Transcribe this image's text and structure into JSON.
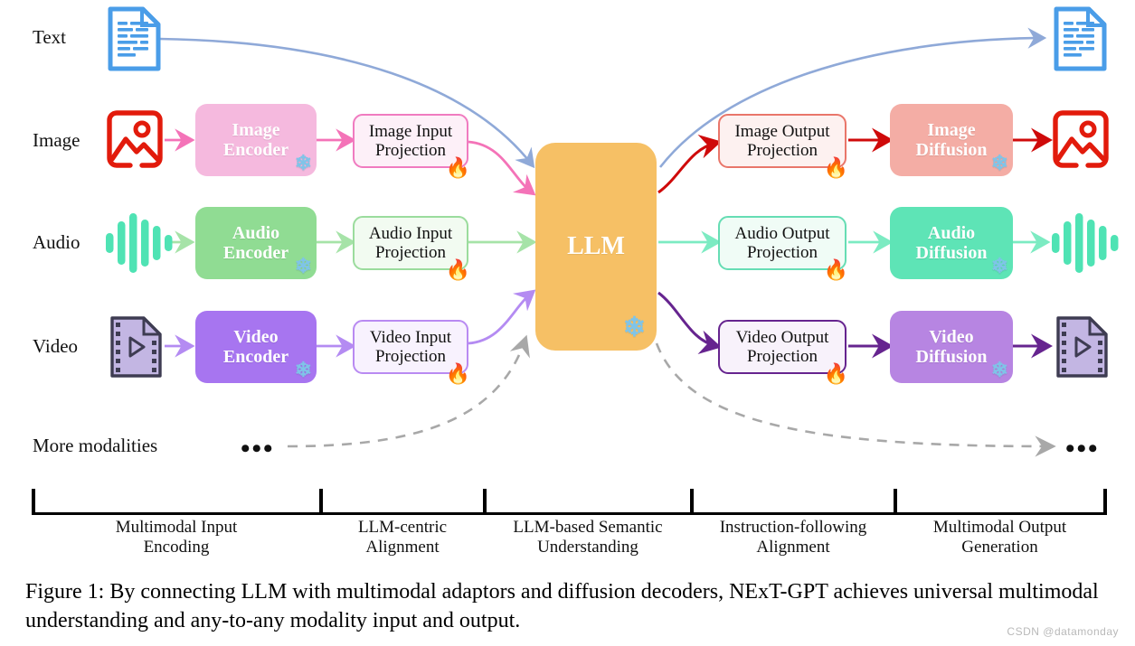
{
  "figure": {
    "caption": "Figure 1: By connecting LLM with multimodal adaptors and diffusion decoders, NExT-GPT achieves universal multimodal understanding and any-to-any modality input and output.",
    "watermark": "CSDN @datamonday"
  },
  "modalities": [
    {
      "label": "Text",
      "icon": "text-document-icon",
      "color": "#4A9DE8"
    },
    {
      "label": "Image",
      "icon": "image-picture-icon",
      "color": "#E21B0C"
    },
    {
      "label": "Audio",
      "icon": "audio-waveform-icon",
      "color": "#4FE3B4"
    },
    {
      "label": "Video",
      "icon": "video-film-icon",
      "color": "#9B89C9"
    },
    {
      "label": "More modalities",
      "icon": "ellipsis-icon",
      "color": "#111111"
    }
  ],
  "encoders": [
    {
      "label_line1": "Image",
      "label_line2": "Encoder",
      "fill": "#F5B9DE",
      "badge": "snowflake"
    },
    {
      "label_line1": "Audio",
      "label_line2": "Encoder",
      "fill": "#90DC93",
      "badge": "snowflake"
    },
    {
      "label_line1": "Video",
      "label_line2": "Encoder",
      "fill": "#A775F0",
      "badge": "snowflake"
    }
  ],
  "input_projections": [
    {
      "label_line1": "Image Input",
      "label_line2": "Projection",
      "fill": "#FDF0F8",
      "border": "#F07BC0",
      "badge": "fire"
    },
    {
      "label_line1": "Audio Input",
      "label_line2": "Projection",
      "fill": "#F2FBF1",
      "border": "#9BDC9D",
      "badge": "fire"
    },
    {
      "label_line1": "Video Input",
      "label_line2": "Projection",
      "fill": "#F8F2FE",
      "border": "#B98AF2",
      "badge": "fire"
    }
  ],
  "llm": {
    "label": "LLM",
    "fill": "#F6C065",
    "text_color": "#FFFFFF",
    "badge": "snowflake"
  },
  "output_projections": [
    {
      "label_line1": "Image Output",
      "label_line2": "Projection",
      "fill": "#FDF1F0",
      "border": "#E9766A",
      "badge": "fire"
    },
    {
      "label_line1": "Audio Output",
      "label_line2": "Projection",
      "fill": "#F0FCF6",
      "border": "#66DDB4",
      "badge": "fire"
    },
    {
      "label_line1": "Video Output",
      "label_line2": "Projection",
      "fill": "#F8F2FB",
      "border": "#66248F",
      "badge": "fire"
    }
  ],
  "diffusions": [
    {
      "label_line1": "Image",
      "label_line2": "Diffusion",
      "fill": "#F4ADA5",
      "badge": "snowflake"
    },
    {
      "label_line1": "Audio",
      "label_line2": "Diffusion",
      "fill": "#5EE4B6",
      "badge": "snowflake"
    },
    {
      "label_line1": "Video",
      "label_line2": "Diffusion",
      "fill": "#B785E2",
      "badge": "snowflake"
    }
  ],
  "stages": [
    {
      "line1": "Multimodal Input",
      "line2": "Encoding"
    },
    {
      "line1": "LLM-centric",
      "line2": "Alignment"
    },
    {
      "line1": "LLM-based Semantic",
      "line2": "Understanding"
    },
    {
      "line1": "Instruction-following",
      "line2": "Alignment"
    },
    {
      "line1": "Multimodal Output",
      "line2": "Generation"
    }
  ],
  "badges": {
    "snowflake": "❄",
    "fire": "🔥",
    "ellipsis": "•••"
  },
  "flow_colors": {
    "text_in": "#8FA9D8",
    "image_in": "#F munge",
    "image_in_color": "#F473B8",
    "audio": "#A6E3A8",
    "video_in": "#B48BF2",
    "image_out": "#CF0A0A",
    "audio_out": "#7CEBC2",
    "video_out": "#66248F",
    "more": "#A8A8A8"
  }
}
